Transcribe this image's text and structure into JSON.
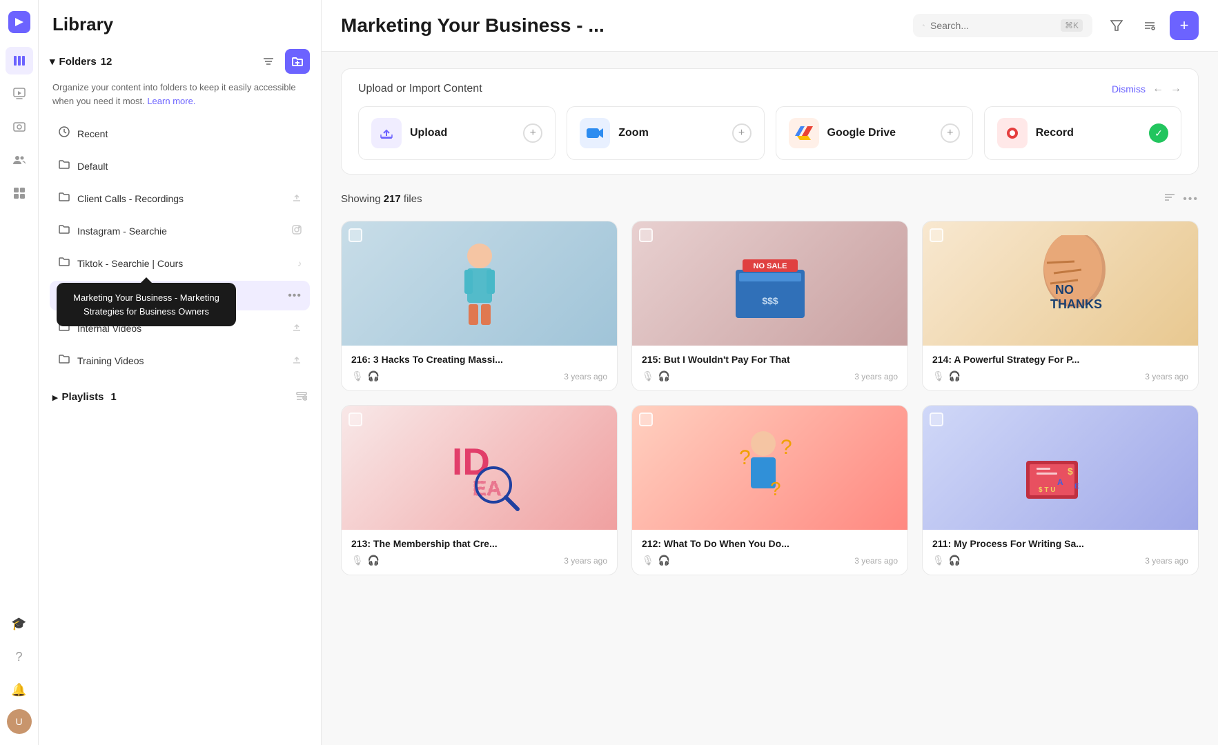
{
  "app": {
    "logo": "▶",
    "sidebar_title": "Library"
  },
  "nav": {
    "icons": [
      {
        "name": "list-icon",
        "symbol": "☰",
        "active": true
      },
      {
        "name": "play-icon",
        "symbol": "▶",
        "active": false
      },
      {
        "name": "screen-icon",
        "symbol": "⊡",
        "active": false
      },
      {
        "name": "team-icon",
        "symbol": "👥",
        "active": false
      },
      {
        "name": "grid-icon",
        "symbol": "⊞",
        "active": false
      }
    ],
    "bottom_icons": [
      {
        "name": "hat-icon",
        "symbol": "🎓"
      },
      {
        "name": "help-icon",
        "symbol": "?"
      },
      {
        "name": "bell-icon",
        "symbol": "🔔"
      }
    ]
  },
  "sidebar": {
    "folders_label": "Folders",
    "folders_count": "12",
    "folders_desc": "Organize your content into folders to keep it easily accessible when you need it most.",
    "learn_more": "Learn more.",
    "items": [
      {
        "name": "Recent",
        "icon": "🕐",
        "type": "recent"
      },
      {
        "name": "Default",
        "icon": "📁",
        "type": "folder"
      },
      {
        "name": "Client Calls - Recordings",
        "icon": "📁",
        "type": "folder",
        "action": "upload"
      },
      {
        "name": "Instagram - Searchie",
        "icon": "📁",
        "type": "folder",
        "action": "instagram"
      },
      {
        "name": "Tiktok - Searchie | Cours",
        "icon": "📁",
        "type": "folder",
        "action": "tiktok"
      },
      {
        "name": "Marketing Your Business ...",
        "icon": "📁",
        "type": "folder",
        "active": true,
        "action": "dots"
      },
      {
        "name": "Internal Videos",
        "icon": "📁",
        "type": "folder",
        "action": "upload"
      },
      {
        "name": "Training Videos",
        "icon": "📁",
        "type": "folder",
        "action": "upload"
      }
    ],
    "tooltip": {
      "text": "Marketing Your Business - Marketing Strategies for Business Owners"
    },
    "playlists_label": "Playlists",
    "playlists_count": "1"
  },
  "header": {
    "title": "Marketing Your Business - ...",
    "search_placeholder": "Search...",
    "search_shortcut": "⌘K",
    "add_button": "+"
  },
  "upload_banner": {
    "title": "Upload or Import Content",
    "dismiss": "Dismiss",
    "options": [
      {
        "label": "Upload",
        "icon": "⬆",
        "bg": "icon-upload-bg",
        "action": "plus",
        "icon_color": "#6c63ff"
      },
      {
        "label": "Zoom",
        "icon": "Z",
        "bg": "icon-zoom-bg",
        "action": "plus",
        "icon_color": "#2d8cf0"
      },
      {
        "label": "Google Drive",
        "icon": "◈",
        "bg": "icon-drive-bg",
        "action": "plus",
        "icon_color": "#ea4335"
      },
      {
        "label": "Record",
        "icon": "⏺",
        "bg": "icon-record-bg",
        "action": "check",
        "icon_color": "#e53e3e"
      }
    ]
  },
  "files": {
    "showing_label": "Showing",
    "count": "217",
    "files_label": "files",
    "items": [
      {
        "id": "216",
        "title": "216: 3 Hacks To Creating Massi...",
        "time": "3 years ago",
        "thumb_class": "thumb-216",
        "thumb_emoji": "🧑"
      },
      {
        "id": "215",
        "title": "215: But I Wouldn't Pay For That",
        "time": "3 years ago",
        "thumb_class": "thumb-215",
        "thumb_emoji": "💰"
      },
      {
        "id": "214",
        "title": "214: A Powerful Strategy For P...",
        "time": "3 years ago",
        "thumb_class": "thumb-214",
        "thumb_emoji": "✋"
      },
      {
        "id": "213",
        "title": "213: The Membership that Cre...",
        "time": "3 years ago",
        "thumb_class": "thumb-213",
        "thumb_emoji": "💡"
      },
      {
        "id": "212",
        "title": "212: What To Do When You Do...",
        "time": "3 years ago",
        "thumb_class": "thumb-212",
        "thumb_emoji": "🤔"
      },
      {
        "id": "211",
        "title": "211: My Process For Writing Sa...",
        "time": "3 years ago",
        "thumb_class": "thumb-211",
        "thumb_emoji": "💻"
      }
    ]
  }
}
